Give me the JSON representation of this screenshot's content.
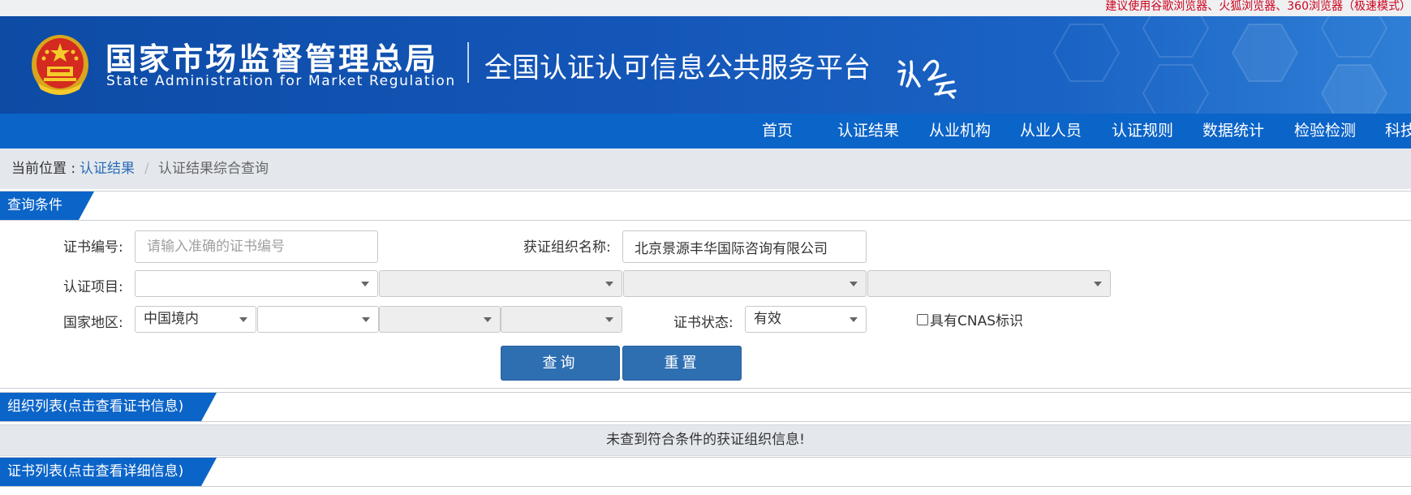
{
  "top_tip": "建议使用谷歌浏览器、火狐浏览器、360浏览器（极速模式）",
  "header": {
    "org_name_cn": "国家市场监督管理总局",
    "org_name_en": "State Administration  for  Market Regulation",
    "platform_title": "全国认证认可信息公共服务平台"
  },
  "nav": {
    "items": [
      "首页",
      "认证结果",
      "从业机构",
      "从业人员",
      "认证规则",
      "数据统计",
      "检验检测",
      "科技"
    ]
  },
  "breadcrumb": {
    "label": "当前位置 :",
    "link": "认证结果",
    "separator": "/",
    "current": "认证结果综合查询"
  },
  "query_section": {
    "title": "查询条件",
    "cert_no_label": "证书编号:",
    "cert_no_placeholder": "请输入准确的证书编号",
    "cert_no_value": "",
    "org_name_label": "获证组织名称:",
    "org_name_value": "北京景源丰华国际咨询有限公司",
    "project_label": "认证项目:",
    "project_selects": [
      "",
      "",
      "",
      ""
    ],
    "region_label": "国家地区:",
    "region_selects": [
      "中国境内",
      "",
      "",
      ""
    ],
    "status_label": "证书状态:",
    "status_value": "有效",
    "cnas_label": "具有CNAS标识",
    "search_button": "查询",
    "reset_button": "重置"
  },
  "org_list": {
    "title": "组织列表(点击查看证书信息)",
    "empty_message": "未查到符合条件的获证组织信息!"
  },
  "cert_list": {
    "title": "证书列表(点击查看详细信息)"
  },
  "colors": {
    "banner_blue": "#1456b8",
    "nav_blue": "#0b64c8",
    "section_tab": "#0b64c8",
    "button_blue": "#2e6fb2",
    "link_blue": "#2b6bb8",
    "tip_red": "#d0021b"
  }
}
